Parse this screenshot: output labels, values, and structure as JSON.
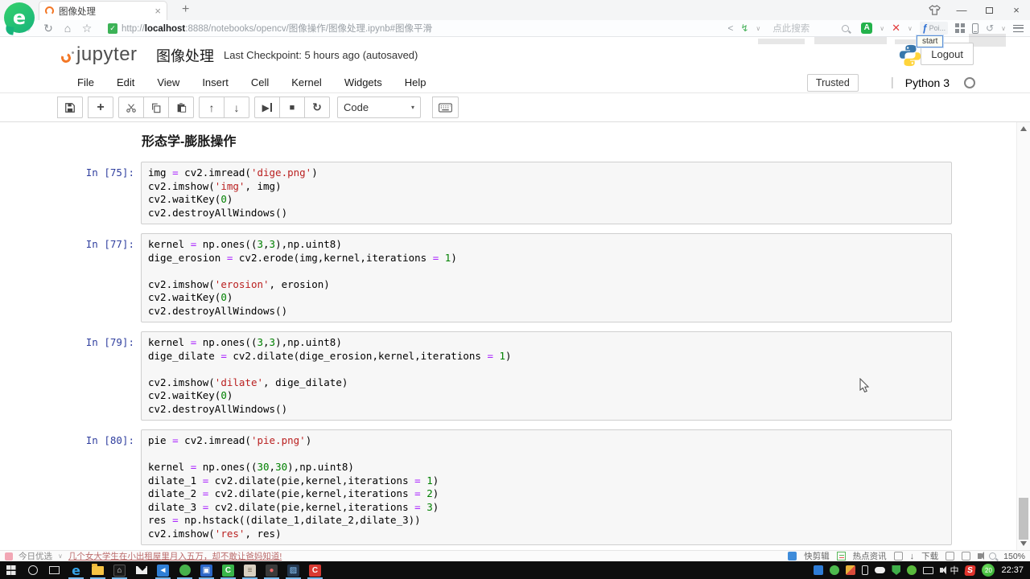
{
  "browser": {
    "tab_title": "图像处理",
    "tab_close": "×",
    "new_tab": "+",
    "nav": {
      "back": "‹",
      "forward": "›",
      "refresh": "↻",
      "home": "⌂",
      "star": "☆"
    },
    "url": {
      "scheme": "http://",
      "host": "localhost",
      "rest": ":8888/notebooks/opencv/图像操作/图像处理.ipynb#图像平滑"
    },
    "search_placeholder": "点此搜索",
    "ext_poi_label": "Poi...",
    "window": {
      "min": "—",
      "close": "×"
    }
  },
  "jupyter": {
    "logo_word": "jupyter",
    "title": "图像处理",
    "checkpoint": "Last Checkpoint: 5 hours ago (autosaved)",
    "logout": "Logout",
    "start_tip": "start",
    "menu": [
      "File",
      "Edit",
      "View",
      "Insert",
      "Cell",
      "Kernel",
      "Widgets",
      "Help"
    ],
    "trusted": "Trusted",
    "kernel_sep": "|",
    "kernel_name": "Python 3",
    "cell_type_selected": "Code",
    "select_caret": "▾",
    "toolbar_glyphs": {
      "add": "+",
      "up": "↑",
      "down": "↓",
      "run": "▶",
      "stop": "■",
      "restart": "↻"
    },
    "heading": "形态学-膨胀操作",
    "cells": [
      {
        "prompt": "In [75]:",
        "lines": [
          [
            {
              "t": "img "
            },
            {
              "t": "=",
              "c": "op"
            },
            {
              "t": " cv2.imread("
            },
            {
              "t": "'dige.png'",
              "c": "str"
            },
            {
              "t": ")"
            }
          ],
          [
            {
              "t": "cv2.imshow("
            },
            {
              "t": "'img'",
              "c": "str"
            },
            {
              "t": ", img)"
            }
          ],
          [
            {
              "t": "cv2.waitKey("
            },
            {
              "t": "0",
              "c": "num"
            },
            {
              "t": ")"
            }
          ],
          [
            {
              "t": "cv2.destroyAllWindows()"
            }
          ]
        ]
      },
      {
        "prompt": "In [77]:",
        "lines": [
          [
            {
              "t": "kernel "
            },
            {
              "t": "=",
              "c": "op"
            },
            {
              "t": " np.ones(("
            },
            {
              "t": "3",
              "c": "num"
            },
            {
              "t": ","
            },
            {
              "t": "3",
              "c": "num"
            },
            {
              "t": "),np.uint8)"
            }
          ],
          [
            {
              "t": "dige_erosion "
            },
            {
              "t": "=",
              "c": "op"
            },
            {
              "t": " cv2.erode(img,kernel,iterations "
            },
            {
              "t": "=",
              "c": "op"
            },
            {
              "t": " "
            },
            {
              "t": "1",
              "c": "num"
            },
            {
              "t": ")"
            }
          ],
          [],
          [
            {
              "t": "cv2.imshow("
            },
            {
              "t": "'erosion'",
              "c": "str"
            },
            {
              "t": ", erosion)"
            }
          ],
          [
            {
              "t": "cv2.waitKey("
            },
            {
              "t": "0",
              "c": "num"
            },
            {
              "t": ")"
            }
          ],
          [
            {
              "t": "cv2.destroyAllWindows()"
            }
          ]
        ]
      },
      {
        "prompt": "In [79]:",
        "lines": [
          [
            {
              "t": "kernel "
            },
            {
              "t": "=",
              "c": "op"
            },
            {
              "t": " np.ones(("
            },
            {
              "t": "3",
              "c": "num"
            },
            {
              "t": ","
            },
            {
              "t": "3",
              "c": "num"
            },
            {
              "t": "),np.uint8)"
            }
          ],
          [
            {
              "t": "dige_dilate "
            },
            {
              "t": "=",
              "c": "op"
            },
            {
              "t": " cv2.dilate(dige_erosion,kernel,iterations "
            },
            {
              "t": "=",
              "c": "op"
            },
            {
              "t": " "
            },
            {
              "t": "1",
              "c": "num"
            },
            {
              "t": ")"
            }
          ],
          [],
          [
            {
              "t": "cv2.imshow("
            },
            {
              "t": "'dilate'",
              "c": "str"
            },
            {
              "t": ", dige_dilate)"
            }
          ],
          [
            {
              "t": "cv2.waitKey("
            },
            {
              "t": "0",
              "c": "num"
            },
            {
              "t": ")"
            }
          ],
          [
            {
              "t": "cv2.destroyAllWindows()"
            }
          ]
        ]
      },
      {
        "prompt": "In [80]:",
        "lines": [
          [
            {
              "t": "pie "
            },
            {
              "t": "=",
              "c": "op"
            },
            {
              "t": " cv2.imread("
            },
            {
              "t": "'pie.png'",
              "c": "str"
            },
            {
              "t": ")"
            }
          ],
          [],
          [
            {
              "t": "kernel "
            },
            {
              "t": "=",
              "c": "op"
            },
            {
              "t": " np.ones(("
            },
            {
              "t": "30",
              "c": "num"
            },
            {
              "t": ","
            },
            {
              "t": "30",
              "c": "num"
            },
            {
              "t": "),np.uint8)"
            }
          ],
          [
            {
              "t": "dilate_1 "
            },
            {
              "t": "=",
              "c": "op"
            },
            {
              "t": " cv2.dilate(pie,kernel,iterations "
            },
            {
              "t": "=",
              "c": "op"
            },
            {
              "t": " "
            },
            {
              "t": "1",
              "c": "num"
            },
            {
              "t": ")"
            }
          ],
          [
            {
              "t": "dilate_2 "
            },
            {
              "t": "=",
              "c": "op"
            },
            {
              "t": " cv2.dilate(pie,kernel,iterations "
            },
            {
              "t": "=",
              "c": "op"
            },
            {
              "t": " "
            },
            {
              "t": "2",
              "c": "num"
            },
            {
              "t": ")"
            }
          ],
          [
            {
              "t": "dilate_3 "
            },
            {
              "t": "=",
              "c": "op"
            },
            {
              "t": " cv2.dilate(pie,kernel,iterations "
            },
            {
              "t": "=",
              "c": "op"
            },
            {
              "t": " "
            },
            {
              "t": "3",
              "c": "num"
            },
            {
              "t": ")"
            }
          ],
          [
            {
              "t": "res "
            },
            {
              "t": "=",
              "c": "op"
            },
            {
              "t": " np.hstack((dilate_1,dilate_2,dilate_3))"
            }
          ],
          [
            {
              "t": "cv2.imshow("
            },
            {
              "t": "'res'",
              "c": "str"
            },
            {
              "t": ", res)"
            }
          ]
        ]
      }
    ],
    "colors": {
      "prompt": "#303F9F",
      "string": "#BA2121",
      "number": "#008000",
      "operator": "#AA22FF",
      "jupyter_orange": "#f37726"
    }
  },
  "statusbar": {
    "today_pick": "今日优选",
    "news_link": "几个女大学生在小出租屋里月入五万，却不敢让爸妈知道!",
    "quick_clip": "快剪辑",
    "hot_news": "热点资讯",
    "download": "下载",
    "download_arrow": "↓",
    "zoom_level": "150%"
  },
  "taskbar": {
    "ime": "中",
    "sogou": "S",
    "ball_value": "20",
    "clock": "22:37"
  }
}
